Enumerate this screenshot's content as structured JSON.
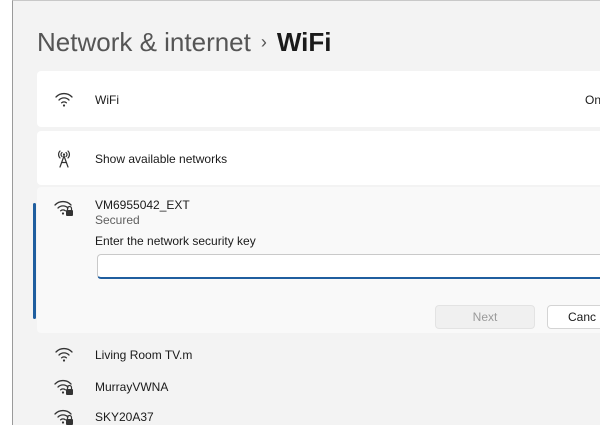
{
  "header": {
    "breadcrumb_parent": "Network & internet",
    "separator": "›",
    "current": "WiFi"
  },
  "wifi_toggle_row": {
    "label": "WiFi",
    "state": "On",
    "icon": "wifi-icon"
  },
  "show_networks_row": {
    "label": "Show available networks",
    "icon": "antenna-icon"
  },
  "selected_network": {
    "ssid": "VM6955042_EXT",
    "security": "Secured",
    "prompt": "Enter the network security key",
    "input_value": "",
    "icon": "secured-wifi-icon",
    "next_label": "Next",
    "cancel_label": "Canc"
  },
  "networks": [
    {
      "ssid": "Living Room TV.m",
      "icon": "wifi-icon"
    },
    {
      "ssid": "MurrayVWNA",
      "icon": "secured-wifi-icon"
    },
    {
      "ssid": "SKY20A37",
      "icon": "secured-wifi-icon"
    }
  ],
  "colors": {
    "accent": "#1f5e9f",
    "background": "#f3f3f3",
    "card": "#ffffff"
  }
}
